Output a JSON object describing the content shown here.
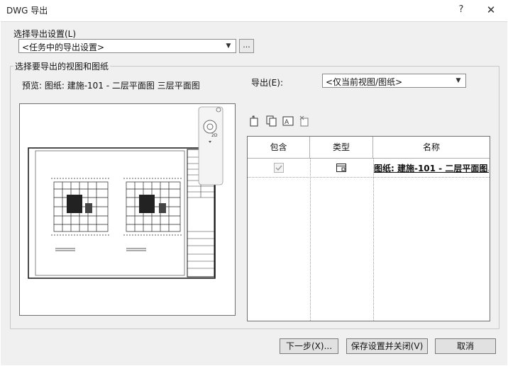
{
  "window": {
    "title": "DWG 导出",
    "help": "?",
    "close": "✕"
  },
  "export_settings": {
    "label": "选择导出设置(L)",
    "selected": "<任务中的导出设置>",
    "more_button": "..."
  },
  "views_group": {
    "title": "选择要导出的视图和图纸",
    "preview_label": "预览: 图纸: 建施-101 - 二层平面图  三层平面图",
    "export_label": "导出(E):",
    "export_selected": "<仅当前视图/图纸>"
  },
  "table": {
    "columns": [
      "包含",
      "类型",
      "名称"
    ],
    "rows": [
      {
        "included": true,
        "type_icon": "sheet-icon",
        "name": "图纸: 建施-101 - 二层平面图..."
      }
    ]
  },
  "buttons": {
    "next": "下一步(X)...",
    "save_close": "保存设置并关闭(V)",
    "cancel": "取消"
  }
}
